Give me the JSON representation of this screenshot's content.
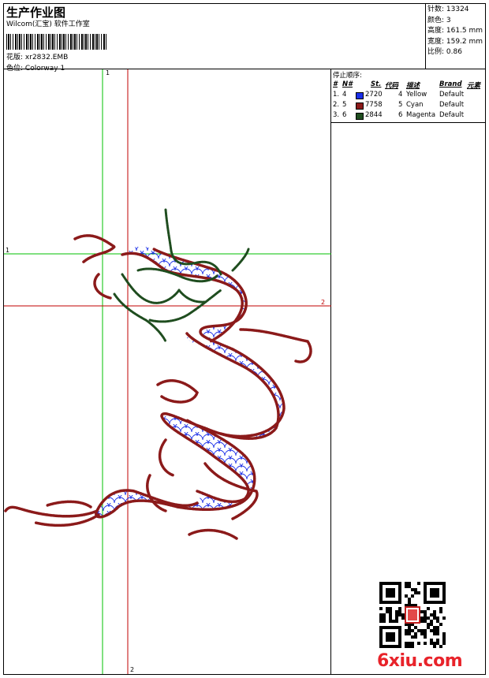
{
  "header": {
    "title": "生产作业图",
    "company": "Wilcom(汇宝) 软件工作室",
    "design_label": "花版:",
    "design_value": "xr2832.EMB",
    "colorway_label": "色位:",
    "colorway_value": "Colorway 1"
  },
  "stats": {
    "stitches": "针数: 13324",
    "colors": "颜色: 3",
    "height": "高度: 161.5 mm",
    "width": "宽度: 159.2 mm",
    "scale": "比例: 0.86"
  },
  "stop_sequence": {
    "title": "停止顺序:",
    "headers": {
      "num": "#",
      "n": "N#",
      "st": "St.",
      "code": "代码",
      "desc": "描述",
      "brand": "Brand",
      "element": "元素"
    },
    "rows": [
      {
        "idx": "1.",
        "n": "4",
        "color": "#1a2ee8",
        "st": "2720",
        "code": "4",
        "desc": "Yellow",
        "brand": "Default"
      },
      {
        "idx": "2.",
        "n": "5",
        "color": "#8b1a1a",
        "st": "7758",
        "code": "5",
        "desc": "Cyan",
        "brand": "Default"
      },
      {
        "idx": "3.",
        "n": "6",
        "color": "#1f4d1f",
        "st": "2844",
        "code": "6",
        "desc": "Magenta",
        "brand": "Default"
      }
    ]
  },
  "guides": {
    "v1": "1",
    "v2": "2",
    "h1": "1",
    "h2": "2",
    "v_color": "#00c000",
    "h_color": "#00c000",
    "v2_color": "#c00000",
    "h2_color": "#c00000"
  },
  "embroidery": {
    "fill_color": "#1a2ee8",
    "outline_color": "#8b1a1a",
    "head_color": "#1f4d1f"
  },
  "watermark": {
    "logo": "6xiu.com"
  }
}
